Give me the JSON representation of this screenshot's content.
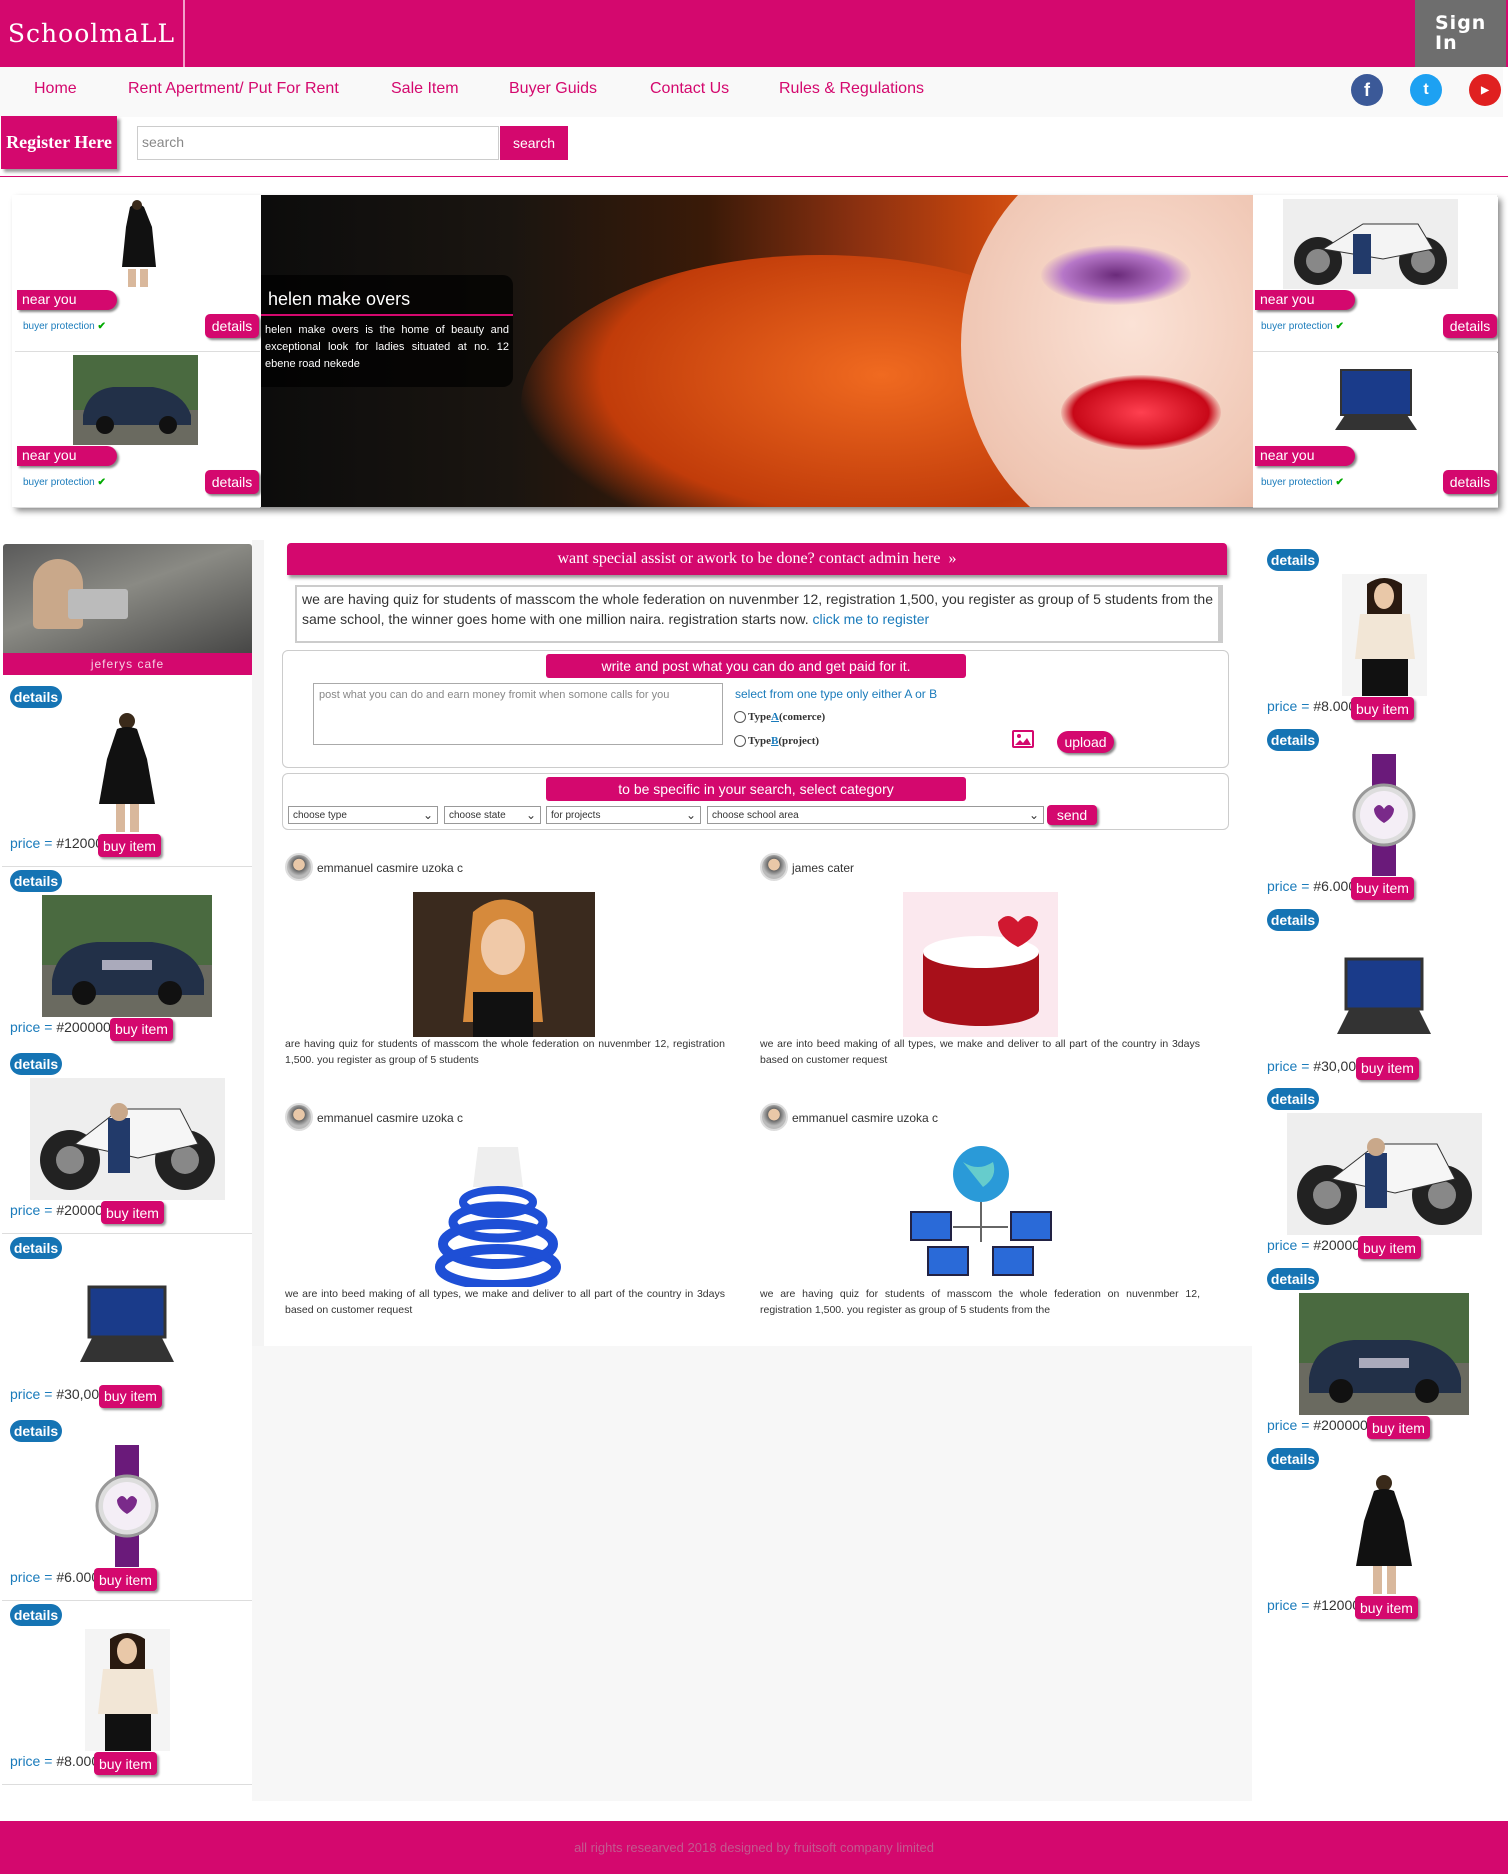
{
  "header": {
    "logo": "SchoolmaLL",
    "sign_in": "Sign In"
  },
  "nav": [
    "Home",
    "Rent Apertment/ Put For Rent",
    "Sale Item",
    "Buyer Guids",
    "Contact Us",
    "Rules & Regulations"
  ],
  "social": [
    "facebook-icon",
    "twitter-icon",
    "youtube-icon"
  ],
  "register_label": "Register Here",
  "search": {
    "placeholder": "search",
    "button": "search"
  },
  "hero": {
    "caption_title": "helen make overs",
    "caption_text": "helen make overs is the home of beauty and exceptional look for ladies situated at no. 12 ebene road nekede",
    "near_you": "near you",
    "buyer_protection": "buyer protection",
    "details": "details"
  },
  "left_ad_label": "jeferys cafe",
  "product_labels": {
    "details": "details",
    "price": "price =",
    "buy": "buy item"
  },
  "left_products": [
    {
      "item": "black dress",
      "price": "#12000"
    },
    {
      "item": "bmw car",
      "price": "#2000000"
    },
    {
      "item": "motorcycle",
      "price": "#200000"
    },
    {
      "item": "laptop",
      "price": "#30,000"
    },
    {
      "item": "purple watch",
      "price": "#6.000"
    },
    {
      "item": "white top",
      "price": "#8.000"
    }
  ],
  "right_products": [
    {
      "item": "white top",
      "price": "#8.000"
    },
    {
      "item": "purple watch",
      "price": "#6.000"
    },
    {
      "item": "laptop",
      "price": "#30,000"
    },
    {
      "item": "motorcycle",
      "price": "#200000"
    },
    {
      "item": "bmw car",
      "price": "#2000000"
    },
    {
      "item": "black dress",
      "price": "#12000"
    }
  ],
  "center": {
    "cta": "want special assist or awork to be done? contact admin here",
    "notice": "we are having quiz for students of masscom the whole federation on nuvenmber 12, registration 1,500, you register as group of 5 students from the same school, the winner goes home with one million naira. registration starts now.",
    "notice_link": "click me to register",
    "post_title": "write and post what you can do and get paid for it.",
    "post_placeholder": "post what you can do and earn money fromit when somone calls for you",
    "select_text": "select from one type only either A or B",
    "type_a_prefix": "Type ",
    "type_a": "A",
    "type_a_suffix": " (comerce)",
    "type_b_prefix": "Type ",
    "type_b": "B",
    "type_b_suffix": " (project)",
    "upload": "upload",
    "category_title": "to be specific in your search, select category",
    "selects": [
      "choose type",
      "choose state",
      "for projects",
      "choose school area"
    ],
    "send": "send"
  },
  "posts": [
    {
      "author": "emmanuel casmire uzoka c",
      "image": "blonde woman",
      "text": "are having quiz for students of masscom the whole federation on nuvenmber 12, registration 1,500. you register as group of 5 students"
    },
    {
      "author": "james cater",
      "image": "birthday cake",
      "text": "we are into beed making of all types, we make and deliver to all part of the country in 3days based on customer request"
    },
    {
      "author": "emmanuel casmire uzoka c",
      "image": "blue bead necklace",
      "text": "we are into beed making of all types, we make and deliver to all part of the country in 3days based on customer request"
    },
    {
      "author": "emmanuel casmire uzoka c",
      "image": "network globe",
      "text": "we are having quiz for students of masscom the whole federation on nuvenmber 12, registration 1,500. you register as group of 5 students from the"
    }
  ],
  "footer": "all rights researved 2018 designed by fruitsoft company limited",
  "colors": {
    "brand": "#d4086e",
    "link": "#1a7bbb",
    "pill": "#1574b4"
  }
}
